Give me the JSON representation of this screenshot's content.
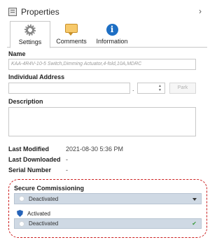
{
  "window": {
    "title": "Properties",
    "collapse_icon": "chevron-right-icon"
  },
  "tabs": [
    {
      "label": "Settings",
      "icon": "gear-icon",
      "active": true
    },
    {
      "label": "Comments",
      "icon": "comment-icon",
      "active": false
    },
    {
      "label": "Information",
      "icon": "info-icon",
      "active": false
    }
  ],
  "fields": {
    "name_label": "Name",
    "name_placeholder": "KAA-4R4V-10-5 Switch,Dimming Actuator,4-fold,10A,MDRC",
    "address_label": "Individual Address",
    "address_separator": ".",
    "park_label": "Park",
    "description_label": "Description"
  },
  "meta": {
    "last_modified_label": "Last Modified",
    "last_modified_value": "2021-08-30 5:36 PM",
    "last_downloaded_label": "Last Downloaded",
    "last_downloaded_value": "-",
    "serial_number_label": "Serial Number",
    "serial_number_value": "-"
  },
  "secure_commissioning": {
    "label": "Secure Commissioning",
    "selected": "Deactivated",
    "options": [
      {
        "label": "Activated",
        "icon": "shield-icon"
      },
      {
        "label": "Deactivated",
        "icon": "radio-icon",
        "selected": true
      }
    ]
  },
  "colors": {
    "highlight_border": "#cc2020",
    "info_icon": "#1e6fc4",
    "dropdown_bg": "#cfd9e4"
  }
}
